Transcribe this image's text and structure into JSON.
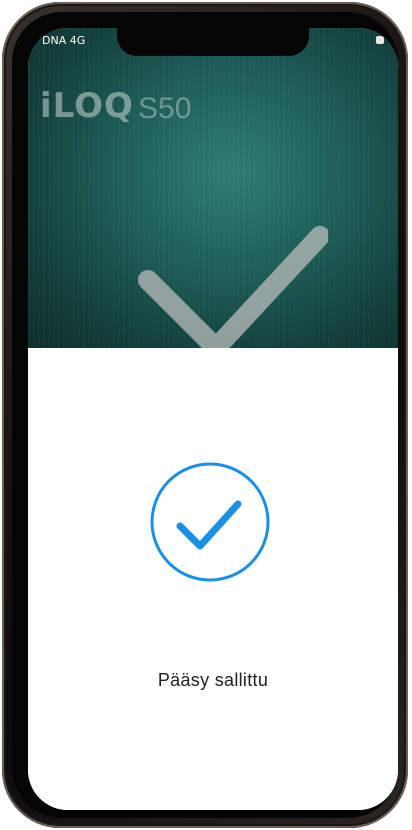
{
  "status_bar": {
    "carrier": "DNA  4G"
  },
  "camera_view": {
    "brand": "iLOQ",
    "model": "S50",
    "check_icon": "checkmark-icon"
  },
  "result": {
    "icon": "check-circle-icon",
    "message": "Pääsy sallittu"
  },
  "colors": {
    "accent": "#1a8fe3",
    "teal_background": "#1e5f58",
    "text": "#222222"
  }
}
